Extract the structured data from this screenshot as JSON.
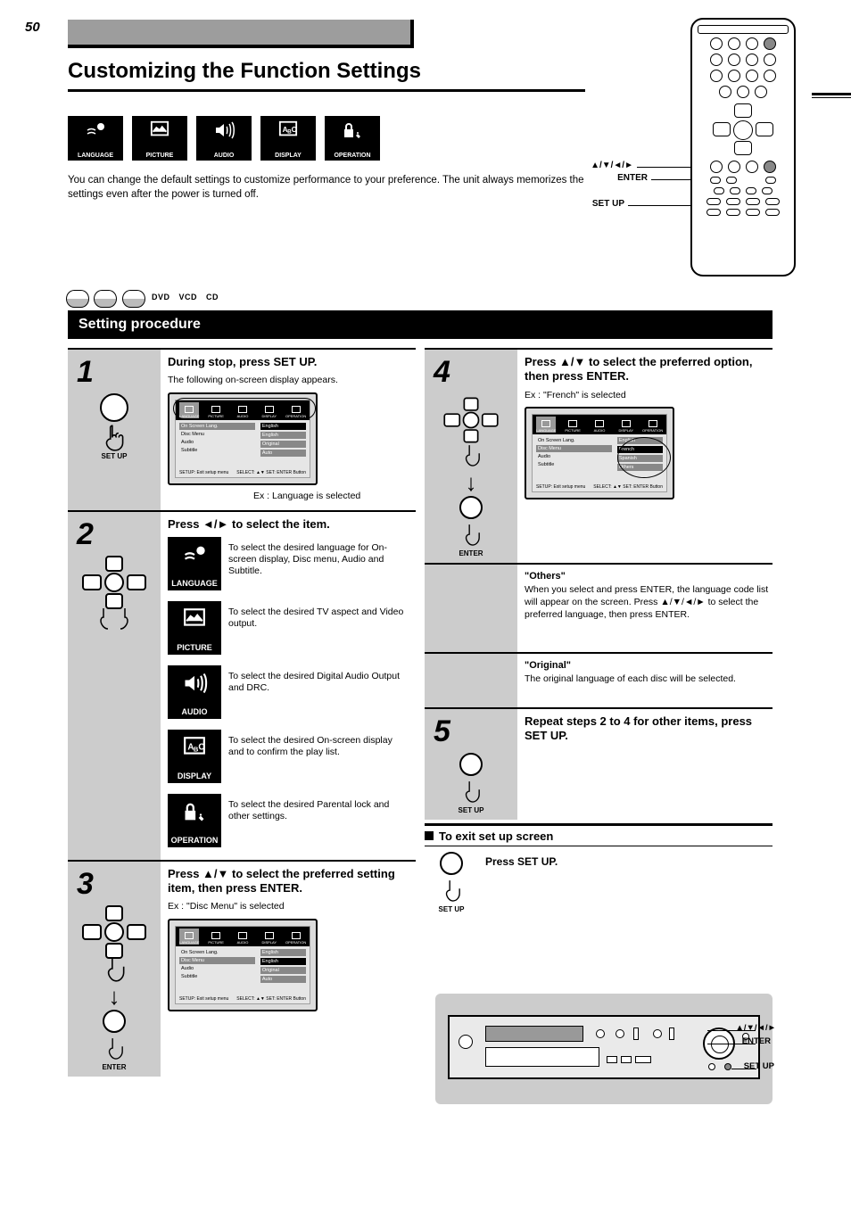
{
  "page_number": "50",
  "header_title": "Customizing the Function Settings",
  "intro_text": "You can change the default settings to customize performance to your preference. The unit always memorizes the settings even after the power is turned off.",
  "categories": {
    "language": "LANGUAGE",
    "picture": "PICTURE",
    "audio": "AUDIO",
    "display": "DISPLAY",
    "operation": "OPERATION"
  },
  "remote_labels": {
    "setup": "SET UP",
    "enter": "ENTER",
    "arrows": "▲/▼/◄/►"
  },
  "disc_types": [
    "DVD",
    "VCD",
    "CD"
  ],
  "black_bar_title": "Setting procedure",
  "steps": {
    "1": {
      "num": "1",
      "left_caption": "SET UP",
      "title": "During stop, press SET UP.",
      "sub": "The following on-screen display appears.",
      "tv_ex_caption": "Ex : Language is selected"
    },
    "2": {
      "num": "2",
      "left_caption": "",
      "title": "Press ◄/► to select the item.",
      "items": {
        "language": {
          "label": "LANGUAGE",
          "desc": "To select the desired language for On-screen display, Disc menu, Audio and Subtitle."
        },
        "picture": {
          "label": "PICTURE",
          "desc": "To select the desired TV aspect and Video output."
        },
        "audio": {
          "label": "AUDIO",
          "desc": "To select the desired Digital Audio Output and DRC."
        },
        "display": {
          "label": "DISPLAY",
          "desc": "To select the desired On-screen display and to confirm the play list."
        },
        "operation": {
          "label": "OPERATION",
          "desc": "To select the desired Parental lock and other settings."
        }
      }
    },
    "3": {
      "num": "3",
      "left_caption": "ENTER",
      "title": "Press ▲/▼ to select the preferred setting item, then press ENTER.",
      "tv_ex_caption": "Ex : \"Disc Menu\" is selected"
    },
    "4": {
      "num": "4",
      "left_caption": "ENTER",
      "title": "Press ▲/▼ to select the preferred option, then press ENTER.",
      "tv_ex_caption": "Ex : \"French\" is selected"
    },
    "note1_label": "\"Others\"",
    "note1_text": "When you select and press ENTER, the language code list will appear on the screen. Press ▲/▼/◄/► to select the preferred language, then press ENTER.",
    "note2_label": "\"Original\"",
    "note2_text": "The original language of each disc will be selected.",
    "5": {
      "num": "5",
      "left_caption": "SET UP",
      "title": "Repeat steps 2 to 4 for other items, press SET UP."
    }
  },
  "exit": {
    "title": "To exit set up screen",
    "text": "Press SET UP.",
    "caption": "SET UP"
  },
  "front_panel": {
    "enter_label": "ENTER",
    "arrows_label": "▲/▼/◄/►",
    "setup_label": "SET UP"
  },
  "tv_menu": {
    "lang_items": [
      "On Screen Lang.",
      "Disc Menu",
      "Audio",
      "Subtitle"
    ],
    "lang_values": [
      "English",
      "English",
      "Original",
      "Auto"
    ],
    "lang_options": [
      "English",
      "French",
      "Spanish",
      "Others"
    ],
    "hint_left": "SETUP: Exit setup menu",
    "hint_right": "SELECT: ▲▼   SET: ENTER Button"
  }
}
